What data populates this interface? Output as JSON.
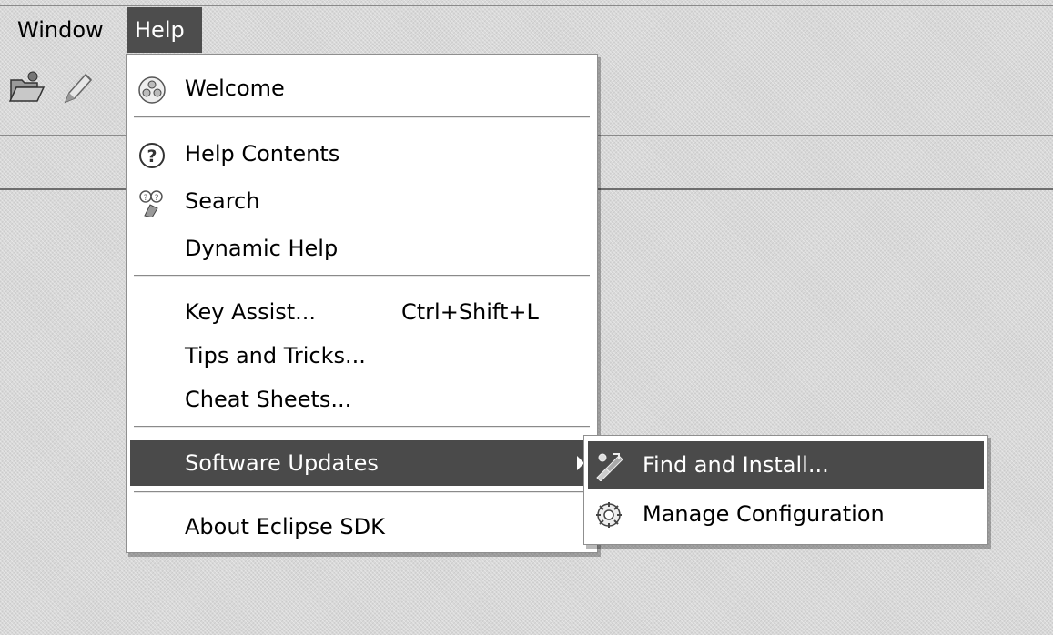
{
  "menubar": {
    "items": [
      {
        "label": "Window"
      },
      {
        "label": "Help"
      }
    ]
  },
  "toolbar": {
    "icons": [
      "open-folder-icon",
      "pen-icon"
    ]
  },
  "help_menu": {
    "items": [
      {
        "label": "Welcome",
        "icon": "welcome-icon"
      },
      {
        "label": "Help Contents",
        "icon": "question-icon"
      },
      {
        "label": "Search",
        "icon": "search-icon"
      },
      {
        "label": "Dynamic Help"
      },
      {
        "label": "Key Assist...",
        "accelerator": "Ctrl+Shift+L"
      },
      {
        "label": "Tips and Tricks..."
      },
      {
        "label": "Cheat Sheets..."
      },
      {
        "label": "Software Updates",
        "has_submenu": true,
        "highlighted": true
      },
      {
        "label": "About Eclipse SDK"
      }
    ]
  },
  "software_updates_submenu": {
    "items": [
      {
        "label": "Find and Install...",
        "icon": "find-install-icon",
        "highlighted": true
      },
      {
        "label": "Manage Configuration",
        "icon": "manage-configuration-icon"
      }
    ]
  },
  "colors": {
    "highlight_bg": "#4a4a4a",
    "menu_bg": "#ffffff",
    "window_bg": "#d8d8d8"
  }
}
